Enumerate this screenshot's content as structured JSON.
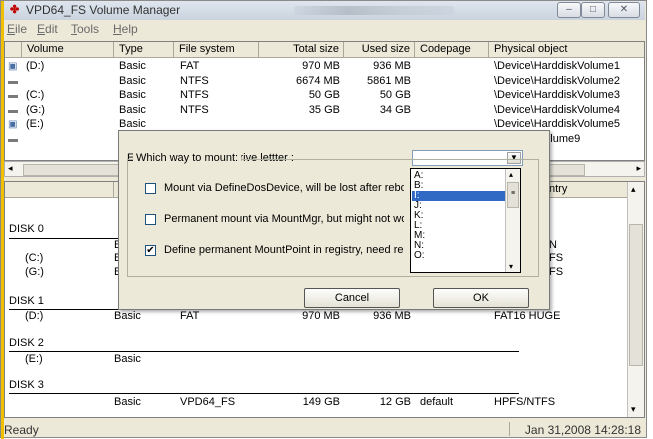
{
  "window": {
    "title": "VPD64_FS Volume Manager",
    "buttons": {
      "minimize": "–",
      "maximize": "□",
      "close": "✕"
    }
  },
  "menu": [
    {
      "key": "E",
      "rest": "ile"
    },
    {
      "key": "E",
      "rest": "dit"
    },
    {
      "key": "T",
      "rest": "ools"
    },
    {
      "key": "H",
      "rest": "elp"
    }
  ],
  "top_table": {
    "headers": [
      "Volume",
      "Type",
      "File system",
      "Total size",
      "Used size",
      "Codepage",
      "Physical object"
    ],
    "rows": [
      {
        "volume": "(D:)",
        "type": "Basic",
        "fs": "FAT",
        "total": "970 MB",
        "used": "936 MB",
        "codepage": "",
        "object": "\\Device\\HarddiskVolume1",
        "icon": "drive-icon"
      },
      {
        "volume": "",
        "type": "Basic",
        "fs": "NTFS",
        "total": "6674 MB",
        "used": "5861 MB",
        "codepage": "",
        "object": "\\Device\\HarddiskVolume2",
        "icon": "disk-icon"
      },
      {
        "volume": "(C:)",
        "type": "Basic",
        "fs": "NTFS",
        "total": "50 GB",
        "used": "50 GB",
        "codepage": "",
        "object": "\\Device\\HarddiskVolume3",
        "icon": "disk-icon"
      },
      {
        "volume": "(G:)",
        "type": "Basic",
        "fs": "NTFS",
        "total": "35 GB",
        "used": "34 GB",
        "codepage": "",
        "object": "\\Device\\HarddiskVolume4",
        "icon": "disk-icon"
      },
      {
        "volume": "(E:)",
        "type": "Basic",
        "fs": "",
        "total": "",
        "used": "",
        "codepage": "",
        "object": "\\Device\\HarddiskVolume5",
        "icon": "drive-icon"
      },
      {
        "volume": "",
        "type": "B",
        "fs": "",
        "total": "",
        "used": "",
        "codepage": "",
        "object": "HarddiskVolume9",
        "icon": "disk-icon"
      }
    ]
  },
  "bottom_table": {
    "header_type_fragment": "T",
    "header_ntfy": "ntry",
    "disks": [
      {
        "label": "DISK 0",
        "rows": [
          {
            "vol": "",
            "type": "Ba",
            "right": "N"
          },
          {
            "vol": "(C:)",
            "type": "Ba",
            "right": "FS"
          },
          {
            "vol": "(G:)",
            "type": "Ba",
            "right": "FS"
          }
        ]
      },
      {
        "label": "DISK 1",
        "rows": [
          {
            "vol": "(D:)",
            "type": "Basic",
            "fs": "FAT",
            "total": "970 MB",
            "used": "936 MB",
            "right": "FAT16 HUGE"
          }
        ]
      },
      {
        "label": "DISK 2",
        "rows": [
          {
            "vol": "(E:)",
            "type": "Basic"
          }
        ]
      },
      {
        "label": "DISK 3",
        "rows": [
          {
            "vol": "",
            "type": "Basic",
            "fs": "VPD64_FS",
            "total": "149 GB",
            "used": "12 GB",
            "codepage": "default",
            "right": "HPFS/NTFS"
          }
        ]
      }
    ]
  },
  "status": {
    "left": "Ready",
    "right": "Jan 31,2008 14:28:18"
  },
  "dialog": {
    "prompt": "Enter or select a new drive lettter :",
    "group_title": "Which way to mount:",
    "options": [
      {
        "label": "Mount via DefineDosDevice, will be lost after reboot",
        "checked": false
      },
      {
        "label": "Permanent mount via MountMgr, but might not work",
        "checked": false
      },
      {
        "label": "Define permanent MountPoint in registry, need reboot",
        "checked": true
      }
    ],
    "cancel_label": "Cancel",
    "ok_label": "OK",
    "drive_letters": [
      "A:",
      "B:",
      "I:",
      "J:",
      "K:",
      "L:",
      "M:",
      "N:",
      "O:"
    ],
    "selected_letter": "I:"
  }
}
